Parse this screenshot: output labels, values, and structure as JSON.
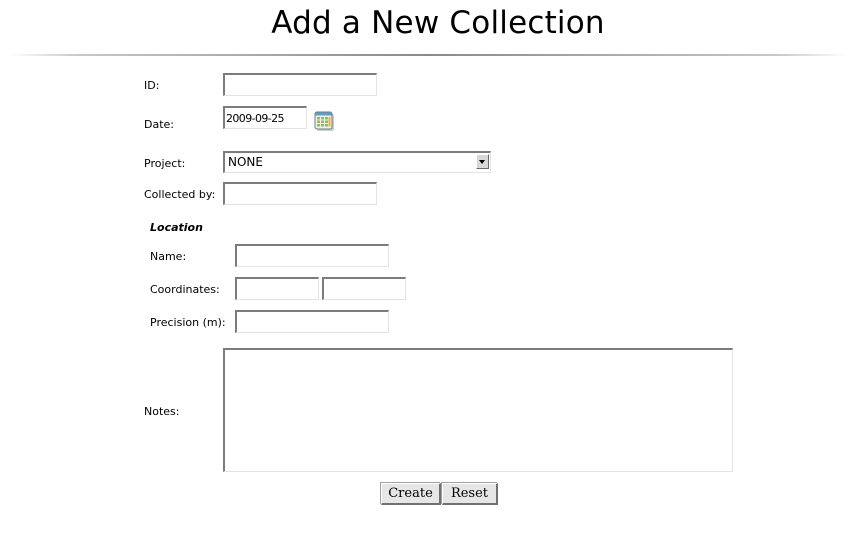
{
  "page": {
    "title": "Add a New Collection"
  },
  "form": {
    "id": {
      "label": "ID:",
      "value": ""
    },
    "date": {
      "label": "Date:",
      "value": "2009-09-25",
      "calendar_icon": "calendar-icon"
    },
    "project": {
      "label": "Project:",
      "selected": "NONE"
    },
    "collected_by": {
      "label": "Collected by:",
      "value": ""
    },
    "location": {
      "heading": "Location",
      "name": {
        "label": "Name:",
        "value": ""
      },
      "coordinates": {
        "label": "Coordinates:",
        "value_1": "",
        "value_2": ""
      },
      "precision": {
        "label": "Precision (m):",
        "value": ""
      }
    },
    "notes": {
      "label": "Notes:",
      "value": ""
    },
    "buttons": {
      "create": "Create",
      "reset": "Reset"
    }
  }
}
